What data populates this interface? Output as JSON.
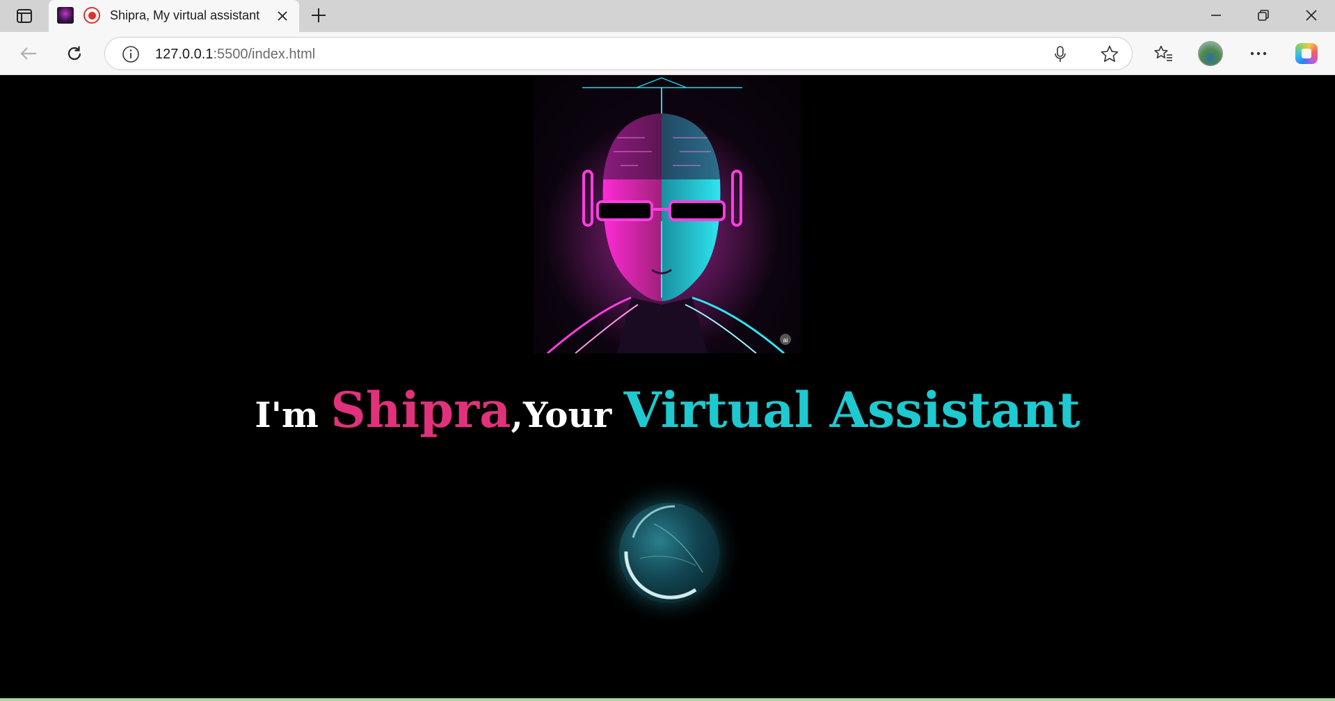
{
  "browser": {
    "tab": {
      "title": "Shipra, My virtual assistant"
    },
    "address": {
      "host": "127.0.0.1",
      "rest": ":5500/index.html"
    }
  },
  "page": {
    "headline": {
      "prefix": "I'm ",
      "name": "Shipra",
      "middle": ",Your ",
      "role": "Virtual Assistant"
    },
    "colors": {
      "name": "#e0327a",
      "role": "#1ec9cf",
      "background": "#000000"
    },
    "hero_image_icon": "ai-robot-portrait",
    "voice_button_icon": "glowing-orb"
  }
}
